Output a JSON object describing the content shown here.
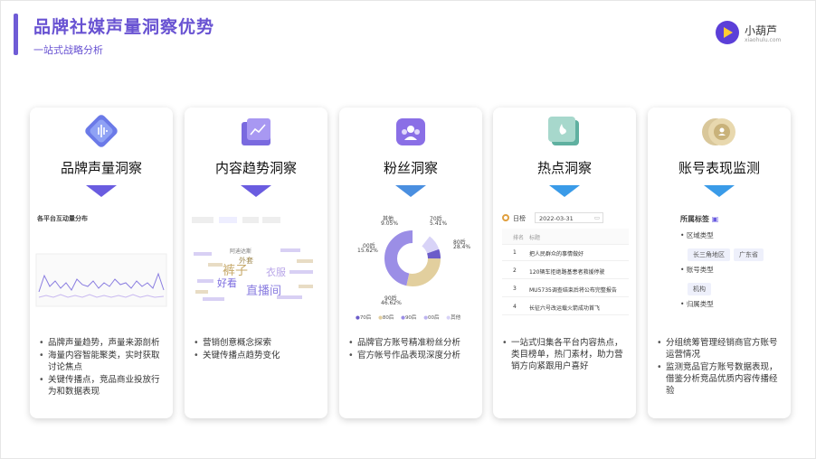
{
  "header": {
    "title": "品牌社媒声量洞察优势",
    "subtitle": "一站式战略分析"
  },
  "logo": {
    "name": "小葫芦",
    "sub": "xiaohulu.com"
  },
  "cards": [
    {
      "title": "品牌声量洞察",
      "icon": "sound-wave-icon",
      "preview": {
        "heading": "各平台互动量分布"
      },
      "bullets": [
        "品牌声量趋势，声量来源剖析",
        "海量内容智能聚类，实时获取讨论焦点",
        "关键传播点，竞品商业投放行为和数据表现"
      ]
    },
    {
      "title": "内容趋势洞察",
      "icon": "trend-chart-icon",
      "preview": {
        "words": [
          "裤子",
          "直播间",
          "好看",
          "衣服",
          "外套",
          "阿迪达斯"
        ]
      },
      "bullets": [
        "营销创意概念探索",
        "关键传播点趋势变化"
      ]
    },
    {
      "title": "粉丝洞察",
      "icon": "fans-group-icon",
      "preview": {
        "donut_labels": [
          {
            "name": "其他",
            "value": "9.05%"
          },
          {
            "name": "70后",
            "value": "5.41%"
          },
          {
            "name": "80后",
            "value": "28.4%"
          },
          {
            "name": "90后",
            "value": "46.62%"
          },
          {
            "name": "00后",
            "value": "15.62%"
          }
        ],
        "legend": [
          "70后",
          "80后",
          "90后",
          "00后",
          "其他"
        ]
      },
      "bullets": [
        "品牌官方账号精准粉丝分析",
        "官方帐号作品表现深度分析"
      ]
    },
    {
      "title": "热点洞察",
      "icon": "hot-flame-icon",
      "preview": {
        "date_label": "日榜",
        "date": "2022-03-31",
        "col_rank": "排名",
        "col_title": "标题",
        "rows": [
          {
            "rank": "1",
            "text": "把人民群众的事情做好"
          },
          {
            "rank": "2",
            "text": "120辆车拒绝路基患者救援停驶"
          },
          {
            "rank": "3",
            "text": "MU5735调查结束后将公布完整报告"
          },
          {
            "rank": "4",
            "text": "长征六号改运载火箭成功首飞"
          }
        ]
      },
      "bullets": [
        "一站式归集各平台内容热点，类目榜单，热门素材，助力营销方向紧跟用户喜好"
      ]
    },
    {
      "title": "账号表现监测",
      "icon": "account-badge-icon",
      "preview": {
        "heading": "所属标签",
        "groups": [
          {
            "label": "区域类型",
            "tags": [
              "长三角地区",
              "广东省"
            ]
          },
          {
            "label": "账号类型",
            "tags": [
              "机构"
            ]
          },
          {
            "label": "归属类型",
            "tags": []
          }
        ]
      },
      "bullets": [
        "分组统筹管理经销商官方账号运营情况",
        "监测竞品官方账号数据表现，借鉴分析竞品优质内容传播经验"
      ]
    }
  ],
  "colors": {
    "accent": "#6852d2",
    "triangle": "#6a5ce0"
  }
}
